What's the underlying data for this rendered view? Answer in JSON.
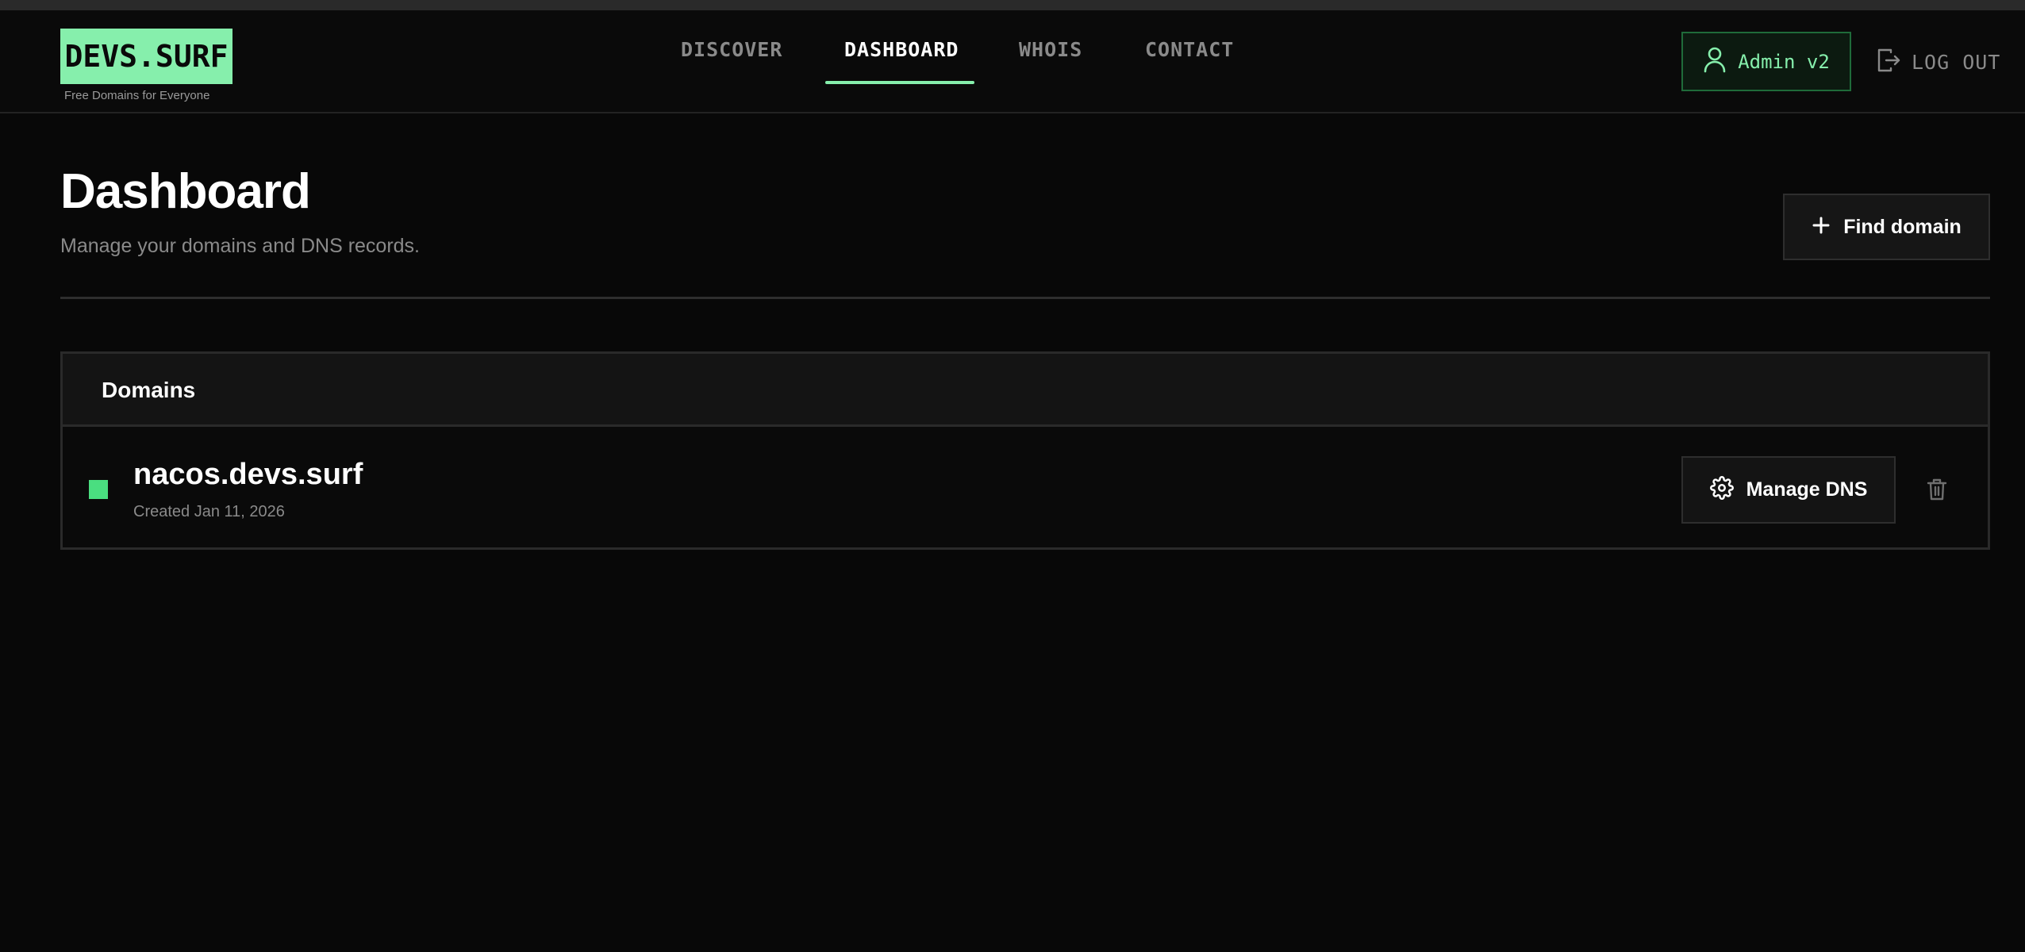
{
  "header": {
    "logo": "DEVS.SURF",
    "tagline": "Free Domains for Everyone",
    "nav": [
      {
        "label": "DISCOVER"
      },
      {
        "label": "DASHBOARD",
        "active": true
      },
      {
        "label": "WHOIS"
      },
      {
        "label": "CONTACT"
      }
    ],
    "user": {
      "label": "Admin v2",
      "icon": "user-icon"
    },
    "logout": {
      "label": "LOG OUT",
      "icon": "logout-icon"
    }
  },
  "main": {
    "title": "Dashboard",
    "subtitle": "Manage your domains and DNS records.",
    "find_button": {
      "label": "Find domain",
      "icon": "plus-icon"
    },
    "domains_panel": {
      "title": "Domains",
      "rows": [
        {
          "name": "nacos.devs.surf",
          "created": "Created Jan 11, 2026",
          "status_color": "#4ade80",
          "open_icon": "external-link-icon",
          "manage": {
            "label": "Manage DNS",
            "icon": "gear-icon"
          },
          "delete_icon": "trash-icon"
        }
      ]
    }
  },
  "colors": {
    "accent": "#86efac",
    "background": "#080808",
    "muted_text": "#8a8a8a"
  }
}
